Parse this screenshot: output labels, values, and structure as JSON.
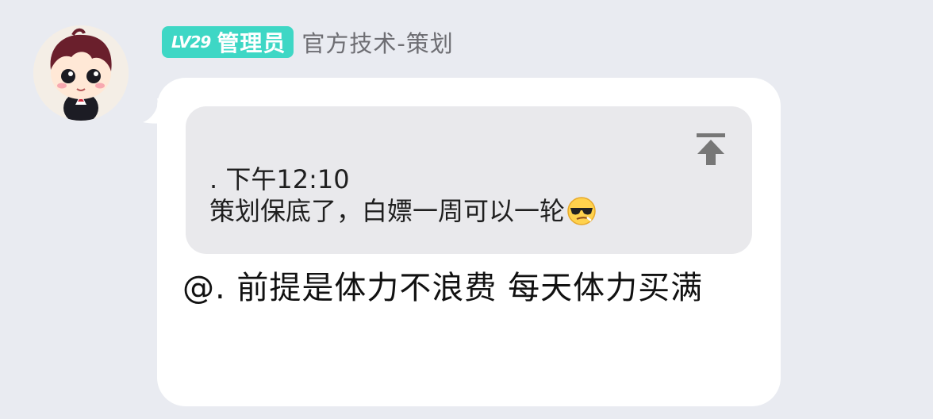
{
  "user": {
    "level": "LV29",
    "role": "管理员",
    "title": "官方技术-策划",
    "avatar_icon": "cartoon-boy-avatar-icon"
  },
  "colors": {
    "page_background": "#e9ebf1",
    "badge": "#3ed7c5",
    "bubble": "#ffffff",
    "quote_background": "#e9e9ec",
    "jump_icon": "#777777"
  },
  "message": {
    "quote": {
      "meta": ". 下午12:10",
      "text": "策划保底了，白嫖一周可以一轮",
      "emoji_icon": "cool-sunglasses-face-icon",
      "jump_icon": "jump-to-top-icon"
    },
    "reply": "@. 前提是体力不浪费 每天体力买满"
  }
}
